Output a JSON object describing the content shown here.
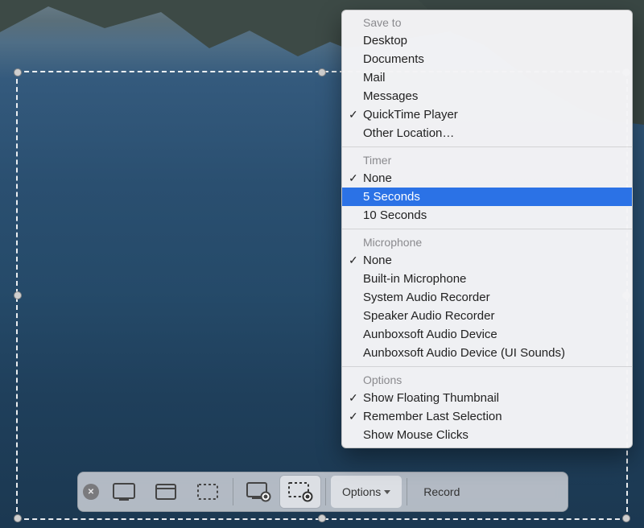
{
  "toolbar": {
    "options_label": "Options",
    "record_label": "Record"
  },
  "menu": {
    "save_to": {
      "header": "Save to",
      "items": [
        {
          "label": "Desktop",
          "checked": false
        },
        {
          "label": "Documents",
          "checked": false
        },
        {
          "label": "Mail",
          "checked": false
        },
        {
          "label": "Messages",
          "checked": false
        },
        {
          "label": "QuickTime Player",
          "checked": true
        },
        {
          "label": "Other Location…",
          "checked": false
        }
      ]
    },
    "timer": {
      "header": "Timer",
      "items": [
        {
          "label": "None",
          "checked": true,
          "highlight": false
        },
        {
          "label": "5 Seconds",
          "checked": false,
          "highlight": true
        },
        {
          "label": "10 Seconds",
          "checked": false,
          "highlight": false
        }
      ]
    },
    "microphone": {
      "header": "Microphone",
      "items": [
        {
          "label": "None",
          "checked": true
        },
        {
          "label": "Built-in Microphone",
          "checked": false
        },
        {
          "label": "System Audio Recorder",
          "checked": false
        },
        {
          "label": "Speaker Audio Recorder",
          "checked": false
        },
        {
          "label": "Aunboxsoft Audio Device",
          "checked": false
        },
        {
          "label": "Aunboxsoft Audio Device (UI Sounds)",
          "checked": false
        }
      ]
    },
    "options": {
      "header": "Options",
      "items": [
        {
          "label": "Show Floating Thumbnail",
          "checked": true
        },
        {
          "label": "Remember Last Selection",
          "checked": true
        },
        {
          "label": "Show Mouse Clicks",
          "checked": false
        }
      ]
    }
  }
}
